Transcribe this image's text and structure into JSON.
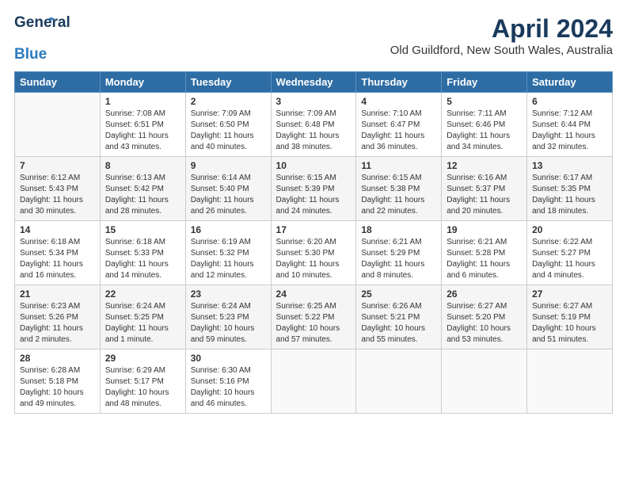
{
  "header": {
    "logo_line1": "General",
    "logo_line2": "Blue",
    "month_title": "April 2024",
    "location": "Old Guildford, New South Wales, Australia"
  },
  "days_of_week": [
    "Sunday",
    "Monday",
    "Tuesday",
    "Wednesday",
    "Thursday",
    "Friday",
    "Saturday"
  ],
  "weeks": [
    [
      {
        "day": "",
        "sunrise": "",
        "sunset": "",
        "daylight": ""
      },
      {
        "day": "1",
        "sunrise": "Sunrise: 7:08 AM",
        "sunset": "Sunset: 6:51 PM",
        "daylight": "Daylight: 11 hours and 43 minutes."
      },
      {
        "day": "2",
        "sunrise": "Sunrise: 7:09 AM",
        "sunset": "Sunset: 6:50 PM",
        "daylight": "Daylight: 11 hours and 40 minutes."
      },
      {
        "day": "3",
        "sunrise": "Sunrise: 7:09 AM",
        "sunset": "Sunset: 6:48 PM",
        "daylight": "Daylight: 11 hours and 38 minutes."
      },
      {
        "day": "4",
        "sunrise": "Sunrise: 7:10 AM",
        "sunset": "Sunset: 6:47 PM",
        "daylight": "Daylight: 11 hours and 36 minutes."
      },
      {
        "day": "5",
        "sunrise": "Sunrise: 7:11 AM",
        "sunset": "Sunset: 6:46 PM",
        "daylight": "Daylight: 11 hours and 34 minutes."
      },
      {
        "day": "6",
        "sunrise": "Sunrise: 7:12 AM",
        "sunset": "Sunset: 6:44 PM",
        "daylight": "Daylight: 11 hours and 32 minutes."
      }
    ],
    [
      {
        "day": "7",
        "sunrise": "Sunrise: 6:12 AM",
        "sunset": "Sunset: 5:43 PM",
        "daylight": "Daylight: 11 hours and 30 minutes."
      },
      {
        "day": "8",
        "sunrise": "Sunrise: 6:13 AM",
        "sunset": "Sunset: 5:42 PM",
        "daylight": "Daylight: 11 hours and 28 minutes."
      },
      {
        "day": "9",
        "sunrise": "Sunrise: 6:14 AM",
        "sunset": "Sunset: 5:40 PM",
        "daylight": "Daylight: 11 hours and 26 minutes."
      },
      {
        "day": "10",
        "sunrise": "Sunrise: 6:15 AM",
        "sunset": "Sunset: 5:39 PM",
        "daylight": "Daylight: 11 hours and 24 minutes."
      },
      {
        "day": "11",
        "sunrise": "Sunrise: 6:15 AM",
        "sunset": "Sunset: 5:38 PM",
        "daylight": "Daylight: 11 hours and 22 minutes."
      },
      {
        "day": "12",
        "sunrise": "Sunrise: 6:16 AM",
        "sunset": "Sunset: 5:37 PM",
        "daylight": "Daylight: 11 hours and 20 minutes."
      },
      {
        "day": "13",
        "sunrise": "Sunrise: 6:17 AM",
        "sunset": "Sunset: 5:35 PM",
        "daylight": "Daylight: 11 hours and 18 minutes."
      }
    ],
    [
      {
        "day": "14",
        "sunrise": "Sunrise: 6:18 AM",
        "sunset": "Sunset: 5:34 PM",
        "daylight": "Daylight: 11 hours and 16 minutes."
      },
      {
        "day": "15",
        "sunrise": "Sunrise: 6:18 AM",
        "sunset": "Sunset: 5:33 PM",
        "daylight": "Daylight: 11 hours and 14 minutes."
      },
      {
        "day": "16",
        "sunrise": "Sunrise: 6:19 AM",
        "sunset": "Sunset: 5:32 PM",
        "daylight": "Daylight: 11 hours and 12 minutes."
      },
      {
        "day": "17",
        "sunrise": "Sunrise: 6:20 AM",
        "sunset": "Sunset: 5:30 PM",
        "daylight": "Daylight: 11 hours and 10 minutes."
      },
      {
        "day": "18",
        "sunrise": "Sunrise: 6:21 AM",
        "sunset": "Sunset: 5:29 PM",
        "daylight": "Daylight: 11 hours and 8 minutes."
      },
      {
        "day": "19",
        "sunrise": "Sunrise: 6:21 AM",
        "sunset": "Sunset: 5:28 PM",
        "daylight": "Daylight: 11 hours and 6 minutes."
      },
      {
        "day": "20",
        "sunrise": "Sunrise: 6:22 AM",
        "sunset": "Sunset: 5:27 PM",
        "daylight": "Daylight: 11 hours and 4 minutes."
      }
    ],
    [
      {
        "day": "21",
        "sunrise": "Sunrise: 6:23 AM",
        "sunset": "Sunset: 5:26 PM",
        "daylight": "Daylight: 11 hours and 2 minutes."
      },
      {
        "day": "22",
        "sunrise": "Sunrise: 6:24 AM",
        "sunset": "Sunset: 5:25 PM",
        "daylight": "Daylight: 11 hours and 1 minute."
      },
      {
        "day": "23",
        "sunrise": "Sunrise: 6:24 AM",
        "sunset": "Sunset: 5:23 PM",
        "daylight": "Daylight: 10 hours and 59 minutes."
      },
      {
        "day": "24",
        "sunrise": "Sunrise: 6:25 AM",
        "sunset": "Sunset: 5:22 PM",
        "daylight": "Daylight: 10 hours and 57 minutes."
      },
      {
        "day": "25",
        "sunrise": "Sunrise: 6:26 AM",
        "sunset": "Sunset: 5:21 PM",
        "daylight": "Daylight: 10 hours and 55 minutes."
      },
      {
        "day": "26",
        "sunrise": "Sunrise: 6:27 AM",
        "sunset": "Sunset: 5:20 PM",
        "daylight": "Daylight: 10 hours and 53 minutes."
      },
      {
        "day": "27",
        "sunrise": "Sunrise: 6:27 AM",
        "sunset": "Sunset: 5:19 PM",
        "daylight": "Daylight: 10 hours and 51 minutes."
      }
    ],
    [
      {
        "day": "28",
        "sunrise": "Sunrise: 6:28 AM",
        "sunset": "Sunset: 5:18 PM",
        "daylight": "Daylight: 10 hours and 49 minutes."
      },
      {
        "day": "29",
        "sunrise": "Sunrise: 6:29 AM",
        "sunset": "Sunset: 5:17 PM",
        "daylight": "Daylight: 10 hours and 48 minutes."
      },
      {
        "day": "30",
        "sunrise": "Sunrise: 6:30 AM",
        "sunset": "Sunset: 5:16 PM",
        "daylight": "Daylight: 10 hours and 46 minutes."
      },
      {
        "day": "",
        "sunrise": "",
        "sunset": "",
        "daylight": ""
      },
      {
        "day": "",
        "sunrise": "",
        "sunset": "",
        "daylight": ""
      },
      {
        "day": "",
        "sunrise": "",
        "sunset": "",
        "daylight": ""
      },
      {
        "day": "",
        "sunrise": "",
        "sunset": "",
        "daylight": ""
      }
    ]
  ]
}
